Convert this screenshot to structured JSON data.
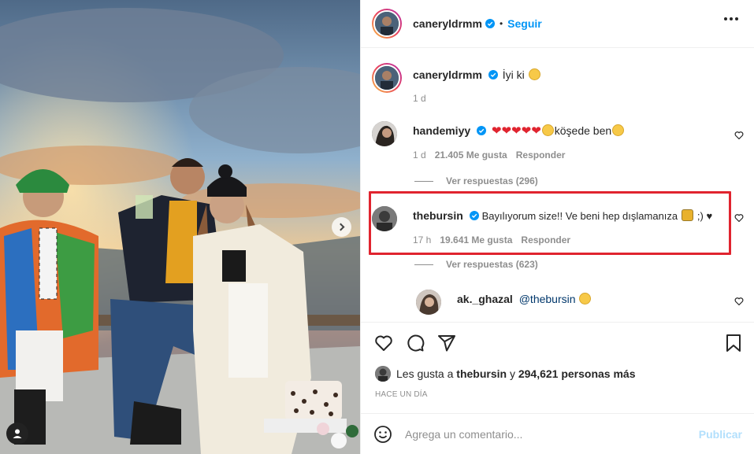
{
  "post": {
    "author": "caneryldrmm",
    "follow_label": "Seguir",
    "dot": "•",
    "caption_user": "caneryldrmm",
    "caption_text": "İyi ki",
    "caption_age": "1 d"
  },
  "comments": [
    {
      "user": "handemiyy",
      "text": "köşede ben",
      "hearts": 5,
      "age": "1 d",
      "likes": "21.405 Me gusta",
      "reply_label": "Responder",
      "view_replies": "Ver respuestas (296)"
    },
    {
      "user": "thebursin",
      "text": "Bayılıyorum size!! Ve beni hep dışlamanıza",
      "text_after": ";) ♥",
      "age": "17 h",
      "likes": "19.641 Me gusta",
      "reply_label": "Responder",
      "view_replies": "Ver respuestas (623)"
    }
  ],
  "reply": {
    "user": "ak._ghazal",
    "mention": "@thebursin"
  },
  "likes_line": {
    "prefix": "Les gusta a",
    "user": "thebursin",
    "suffix": "y",
    "count": "294,621 personas más"
  },
  "timestamp": "Hace un día",
  "comment_box": {
    "placeholder": "Agrega un comentario...",
    "publish_label": "Publicar"
  },
  "colors": {
    "accent": "#0095f6",
    "highlight": "#e0242f",
    "muted": "#8e8e8e"
  }
}
